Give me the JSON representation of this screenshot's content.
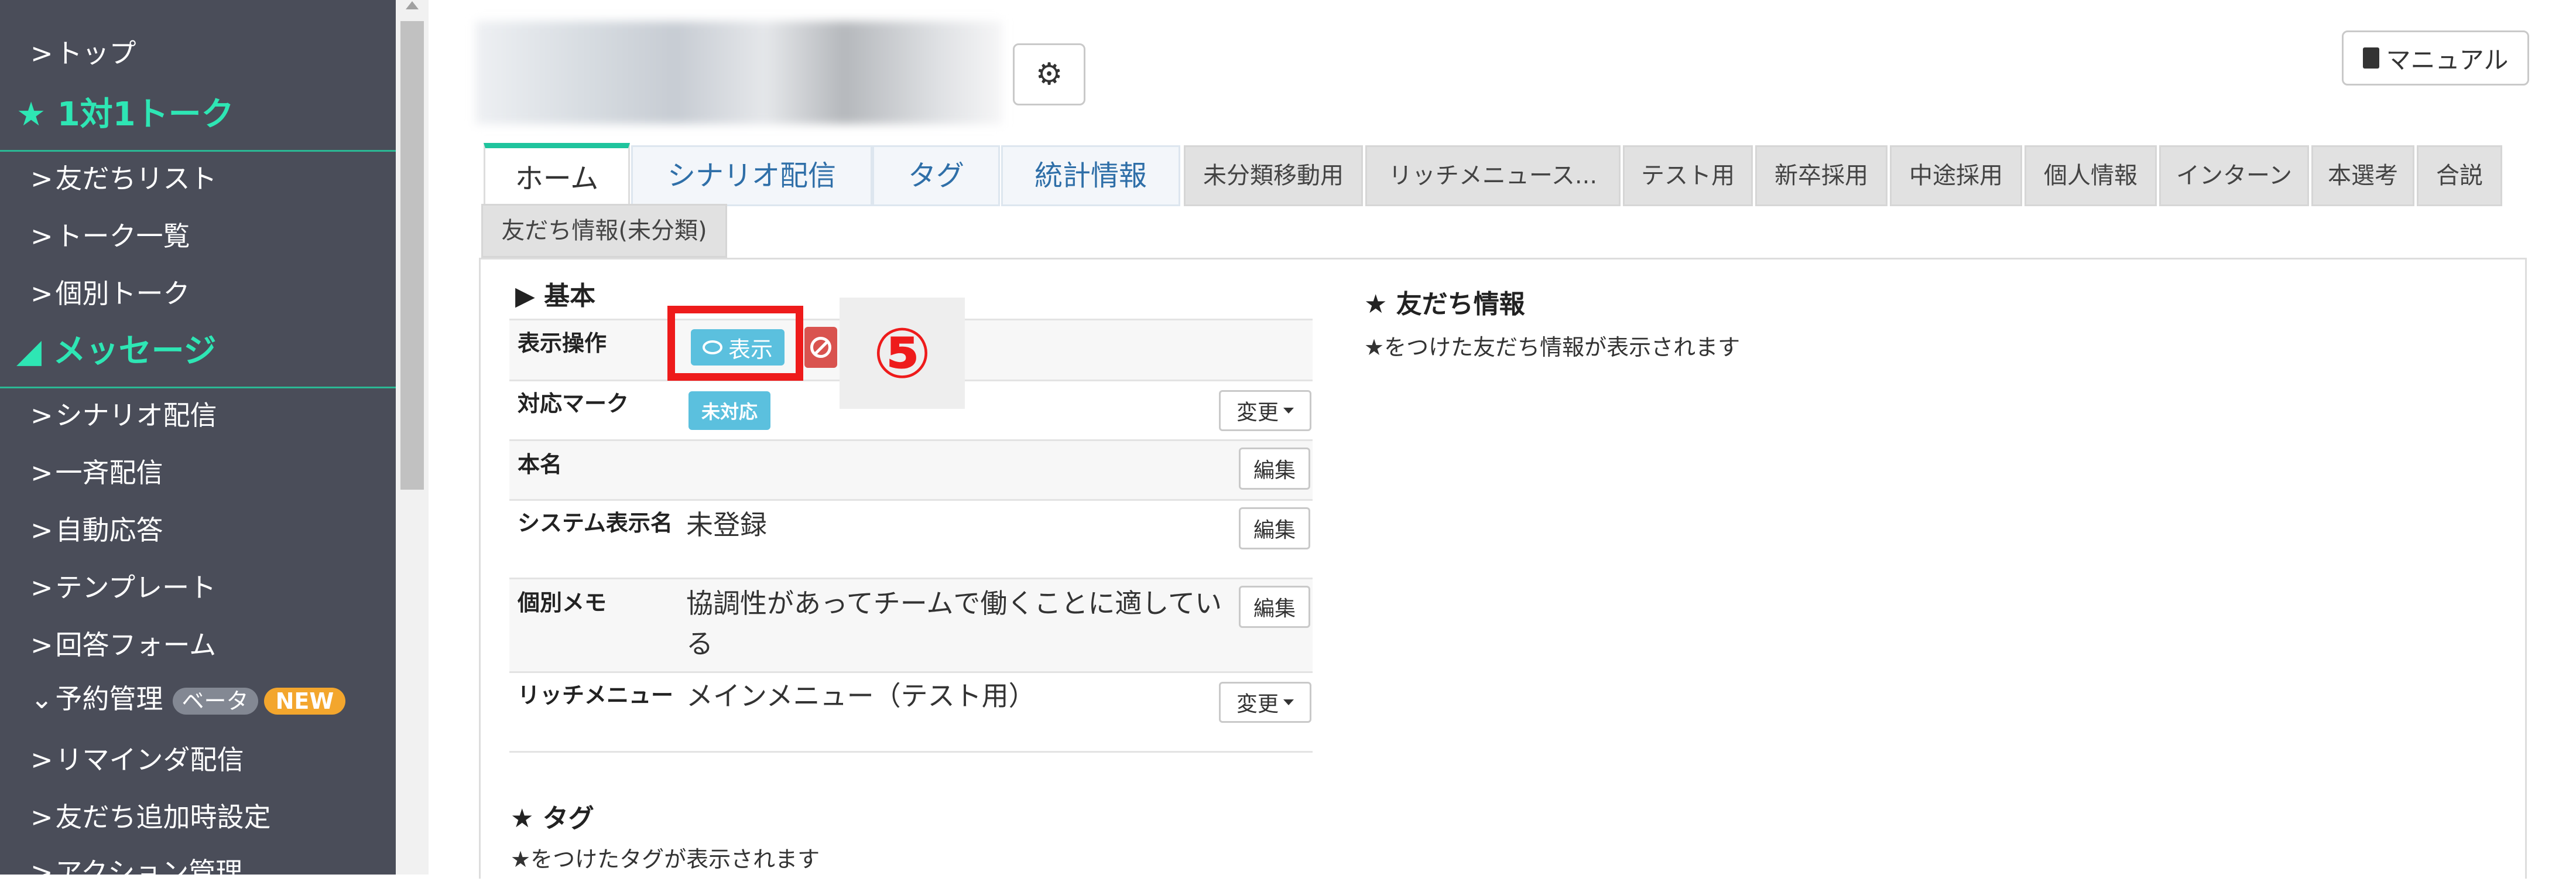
{
  "sidebar": {
    "items": [
      {
        "label": "トップ"
      },
      {
        "label": "友だちリスト"
      },
      {
        "label": "トーク一覧"
      },
      {
        "label": "個別トーク"
      },
      {
        "label": "シナリオ配信"
      },
      {
        "label": "一斉配信"
      },
      {
        "label": "自動応答"
      },
      {
        "label": "テンプレート"
      },
      {
        "label": "回答フォーム"
      },
      {
        "label": "予約管理"
      },
      {
        "label": "リマインダ配信"
      },
      {
        "label": "友だち追加時設定"
      },
      {
        "label": "アクション管理"
      }
    ],
    "section_talk": "★ 1対1トーク",
    "section_message": "メッセージ",
    "badge_beta": "ベータ",
    "badge_new": "NEW"
  },
  "header": {
    "manual_label": "マニュアル"
  },
  "tabs": [
    {
      "label": "ホーム"
    },
    {
      "label": "シナリオ配信"
    },
    {
      "label": "タグ"
    },
    {
      "label": "統計情報"
    },
    {
      "label": "未分類移動用"
    },
    {
      "label": "リッチメニュース..."
    },
    {
      "label": "テスト用"
    },
    {
      "label": "新卒採用"
    },
    {
      "label": "中途採用"
    },
    {
      "label": "個人情報"
    },
    {
      "label": "インターン"
    },
    {
      "label": "本選考"
    },
    {
      "label": "合説"
    },
    {
      "label": "友だち情報(未分類)"
    }
  ],
  "basic": {
    "title": "▶ 基本",
    "rows": [
      {
        "label": "表示操作",
        "value": ""
      },
      {
        "label": "対応マーク",
        "value": ""
      },
      {
        "label": "本名",
        "value": ""
      },
      {
        "label": "システム表示名",
        "value": "未登録"
      },
      {
        "label": "個別メモ",
        "value": "協調性があってチームで働くことに適している"
      },
      {
        "label": "リッチメニュー",
        "value": "メインメニュー（テスト用）"
      }
    ],
    "show_button": "表示",
    "status_badge": "未対応",
    "change_label": "変更",
    "edit_label": "編集",
    "step_marker": "⑤"
  },
  "friend_info": {
    "title": "★ 友だち情報",
    "hint": "★をつけた友だち情報が表示されます"
  },
  "tags_section": {
    "title": "★ タグ",
    "hint": "★をつけたタグが表示されます"
  }
}
